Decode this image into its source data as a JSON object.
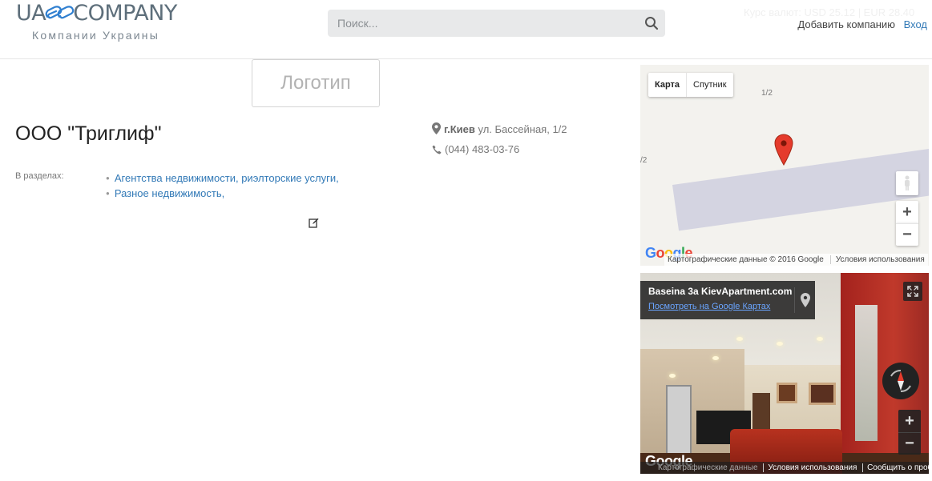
{
  "header": {
    "logo_left": "UA",
    "logo_right": "COMPANY",
    "logo_tagline": "Компании Украины",
    "search_placeholder": "Поиск...",
    "rates": "Курс валют: USD 25.12 | EUR 28.40",
    "add_company": "Добавить компанию",
    "login": "Вход"
  },
  "company": {
    "logo_placeholder": "Логотип",
    "name": "ООО \"Триглиф\"",
    "city": "г.Киев",
    "street": "ул. Бассейная, 1/2",
    "phone": "(044) 483-03-76",
    "sections_label": "В разделах:",
    "sections": [
      {
        "items": [
          {
            "label": "Агентства недвижимости",
            "sep": ", "
          },
          {
            "label": "риэлторские услуги",
            "sep": ","
          }
        ]
      },
      {
        "items": [
          {
            "label": "Разное недвижимость",
            "sep": ","
          }
        ]
      }
    ]
  },
  "map": {
    "type_map": "Карта",
    "type_satellite": "Спутник",
    "house_label_1": "1/2",
    "house_label_2": "/2",
    "google": "Google",
    "attrib_data": "Картографические данные © 2016 Google",
    "attrib_terms": "Условия использования",
    "zoom_in": "+",
    "zoom_out": "−"
  },
  "streetview": {
    "title": "Baseina 3a KievApartment.com",
    "link": "Посмотреть на Google Картах",
    "google": "Google",
    "attrib_data": "Картографические данные",
    "attrib_terms": "Условия использования",
    "attrib_report": "Сообщить о проблеме",
    "zoom_in": "+",
    "zoom_out": "−"
  },
  "colors": {
    "link": "#337ab7",
    "logo": "#5e6f7b",
    "pin": "#e53b2c"
  }
}
